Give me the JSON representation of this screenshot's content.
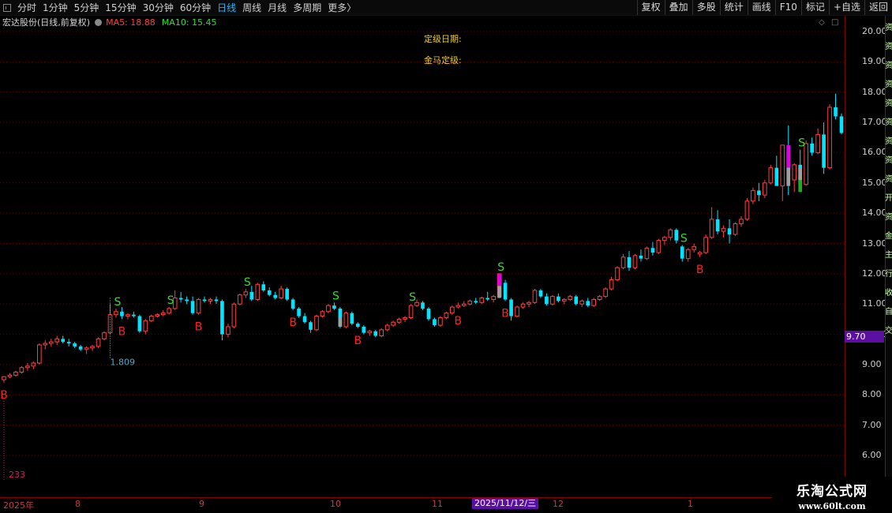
{
  "toolbar": {
    "periods": [
      "分时",
      "1分钟",
      "5分钟",
      "15分钟",
      "30分钟",
      "60分钟",
      "日线",
      "周线",
      "月线",
      "多周期",
      "更多"
    ],
    "active_period": "日线",
    "more_arrow": "〉",
    "right_buttons": [
      "复权",
      "叠加",
      "多股",
      "统计",
      "画线",
      "F10",
      "标记",
      "+自选",
      "返回"
    ]
  },
  "info": {
    "stock_name": "宏达股份(日线,前复权)",
    "ma5_label": "MA5: 18.88",
    "ma10_label": "MA10: 15.45"
  },
  "annotations": {
    "rating_date": "定级日期:",
    "golden_horse": "金马定级:"
  },
  "y_axis": {
    "ticks": [
      "20.00",
      "19.00",
      "18.00",
      "17.00",
      "16.00",
      "15.00",
      "14.00",
      "13.00",
      "12.00",
      "11.00",
      "10.00",
      "9.00",
      "8.00",
      "7.00",
      "6.00"
    ]
  },
  "current_price_tag": "9.70",
  "x_axis": {
    "labels": [
      "2025年",
      "8",
      "9",
      "10",
      "11",
      "12",
      "1"
    ],
    "cursor_date": "2025/11/12/三"
  },
  "chart_marks": {
    "low_marker": "1.809",
    "volume_marker": "233",
    "buy_label": "B",
    "sell_label": "S"
  },
  "right_strip": [
    "资",
    "资",
    "资",
    "资",
    "资",
    "资",
    "资",
    "资",
    "资",
    "开",
    "资",
    "金",
    "主",
    "行",
    "收",
    "自",
    "交"
  ],
  "watermark": {
    "line1": "乐淘公式网",
    "line2": "www.60lt.com"
  },
  "colors": {
    "up": "#ff4040",
    "down": "#00e5ff",
    "buy": "#ff2020",
    "sell": "#33dd33",
    "magenta": "#e000e0",
    "gray": "#a0a0a0",
    "green": "#22aa22"
  },
  "chart_data": {
    "type": "candlestick",
    "title": "",
    "ylim": [
      5.6,
      20.3
    ],
    "candles": [
      [
        8.5,
        8.62,
        8.4,
        8.6
      ],
      [
        8.6,
        8.72,
        8.55,
        8.65
      ],
      [
        8.65,
        8.8,
        8.6,
        8.75
      ],
      [
        8.75,
        8.95,
        8.7,
        8.9
      ],
      [
        8.9,
        9.05,
        8.8,
        8.95
      ],
      [
        8.95,
        9.1,
        8.85,
        9.05
      ],
      [
        9.05,
        9.7,
        9.0,
        9.65
      ],
      [
        9.65,
        9.8,
        9.5,
        9.7
      ],
      [
        9.7,
        9.85,
        9.6,
        9.75
      ],
      [
        9.75,
        9.95,
        9.65,
        9.85
      ],
      [
        9.85,
        9.95,
        9.7,
        9.75
      ],
      [
        9.75,
        9.85,
        9.6,
        9.7
      ],
      [
        9.7,
        9.75,
        9.55,
        9.6
      ],
      [
        9.6,
        9.65,
        9.45,
        9.5
      ],
      [
        9.5,
        9.6,
        9.35,
        9.55
      ],
      [
        9.55,
        9.65,
        9.45,
        9.6
      ],
      [
        9.6,
        9.9,
        9.55,
        9.85
      ],
      [
        9.85,
        10.1,
        9.8,
        10.05
      ],
      [
        10.05,
        11.0,
        10.0,
        10.65
      ],
      [
        10.65,
        10.85,
        10.55,
        10.75
      ],
      [
        10.75,
        10.9,
        10.5,
        10.6
      ],
      [
        10.6,
        10.7,
        10.5,
        10.65
      ],
      [
        10.65,
        10.75,
        10.55,
        10.6
      ],
      [
        10.6,
        10.65,
        10.05,
        10.1
      ],
      [
        10.1,
        10.5,
        10.0,
        10.45
      ],
      [
        10.45,
        10.65,
        10.4,
        10.6
      ],
      [
        10.6,
        10.7,
        10.55,
        10.65
      ],
      [
        10.65,
        10.8,
        10.6,
        10.7
      ],
      [
        10.7,
        10.9,
        10.65,
        10.85
      ],
      [
        10.85,
        11.45,
        10.8,
        11.2
      ],
      [
        11.2,
        11.4,
        11.05,
        11.15
      ],
      [
        11.15,
        11.25,
        11.0,
        11.1
      ],
      [
        11.1,
        11.25,
        10.65,
        10.7
      ],
      [
        10.7,
        11.2,
        10.65,
        11.15
      ],
      [
        11.15,
        11.25,
        11.05,
        11.1
      ],
      [
        11.1,
        11.2,
        11.0,
        11.15
      ],
      [
        11.15,
        11.25,
        11.0,
        11.1
      ],
      [
        11.1,
        11.15,
        9.8,
        10.0
      ],
      [
        10.0,
        10.35,
        9.9,
        10.25
      ],
      [
        10.25,
        11.05,
        10.2,
        11.0
      ],
      [
        11.0,
        11.35,
        10.95,
        11.3
      ],
      [
        11.3,
        11.5,
        11.2,
        11.4
      ],
      [
        11.4,
        11.6,
        11.1,
        11.15
      ],
      [
        11.15,
        11.7,
        11.1,
        11.65
      ],
      [
        11.65,
        11.75,
        11.4,
        11.45
      ],
      [
        11.45,
        11.55,
        11.25,
        11.3
      ],
      [
        11.3,
        11.4,
        11.15,
        11.2
      ],
      [
        11.2,
        11.6,
        11.15,
        11.5
      ],
      [
        11.5,
        11.55,
        11.1,
        11.15
      ],
      [
        11.15,
        11.2,
        10.8,
        10.85
      ],
      [
        10.85,
        10.9,
        10.55,
        10.6
      ],
      [
        10.6,
        10.7,
        10.35,
        10.4
      ],
      [
        10.4,
        10.45,
        10.05,
        10.15
      ],
      [
        10.15,
        10.65,
        10.1,
        10.6
      ],
      [
        10.6,
        10.8,
        10.55,
        10.75
      ],
      [
        10.75,
        11.0,
        10.7,
        10.95
      ],
      [
        10.95,
        11.05,
        10.8,
        10.85
      ],
      [
        10.85,
        10.9,
        10.2,
        10.25
      ],
      [
        10.25,
        10.75,
        10.2,
        10.7
      ],
      [
        10.7,
        10.75,
        10.3,
        10.35
      ],
      [
        10.35,
        10.4,
        10.2,
        10.25
      ],
      [
        10.25,
        10.3,
        10.0,
        10.05
      ],
      [
        10.05,
        10.15,
        9.95,
        10.1
      ],
      [
        10.1,
        10.15,
        9.9,
        9.95
      ],
      [
        9.95,
        10.2,
        9.9,
        10.15
      ],
      [
        10.15,
        10.35,
        10.1,
        10.3
      ],
      [
        10.3,
        10.45,
        10.25,
        10.4
      ],
      [
        10.4,
        10.55,
        10.35,
        10.5
      ],
      [
        10.5,
        10.6,
        10.4,
        10.55
      ],
      [
        10.55,
        11.0,
        10.5,
        10.95
      ],
      [
        10.95,
        11.15,
        10.9,
        11.05
      ],
      [
        11.05,
        11.1,
        10.8,
        10.85
      ],
      [
        10.85,
        10.9,
        10.45,
        10.5
      ],
      [
        10.5,
        10.55,
        10.25,
        10.3
      ],
      [
        10.3,
        10.6,
        10.25,
        10.55
      ],
      [
        10.55,
        10.75,
        10.5,
        10.7
      ],
      [
        10.7,
        10.95,
        10.65,
        10.9
      ],
      [
        10.9,
        11.05,
        10.85,
        10.95
      ],
      [
        10.95,
        11.1,
        10.9,
        11.0
      ],
      [
        11.0,
        11.15,
        10.95,
        11.1
      ],
      [
        11.1,
        11.2,
        11.0,
        11.05
      ],
      [
        11.05,
        11.25,
        11.0,
        11.2
      ],
      [
        11.2,
        11.4,
        11.1,
        11.15
      ],
      [
        11.15,
        11.3,
        11.05,
        11.25
      ],
      [
        11.25,
        12.0,
        11.2,
        12.0
      ],
      [
        11.7,
        11.8,
        11.1,
        11.15
      ],
      [
        11.15,
        11.2,
        10.45,
        10.6
      ],
      [
        10.6,
        10.95,
        10.55,
        10.9
      ],
      [
        10.9,
        11.05,
        10.85,
        11.0
      ],
      [
        11.0,
        11.1,
        10.9,
        11.05
      ],
      [
        11.05,
        11.5,
        11.0,
        11.45
      ],
      [
        11.45,
        11.5,
        11.2,
        11.25
      ],
      [
        11.25,
        11.35,
        10.95,
        11.0
      ],
      [
        11.0,
        11.3,
        10.95,
        11.25
      ],
      [
        11.25,
        11.35,
        11.05,
        11.1
      ],
      [
        11.1,
        11.2,
        11.0,
        11.15
      ],
      [
        11.15,
        11.3,
        11.1,
        11.25
      ],
      [
        11.25,
        11.3,
        10.95,
        11.0
      ],
      [
        11.0,
        11.15,
        10.9,
        11.1
      ],
      [
        11.1,
        11.2,
        10.9,
        10.95
      ],
      [
        10.95,
        11.2,
        10.9,
        11.15
      ],
      [
        11.15,
        11.3,
        11.1,
        11.25
      ],
      [
        11.25,
        11.55,
        11.2,
        11.5
      ],
      [
        11.5,
        11.9,
        11.45,
        11.8
      ],
      [
        11.8,
        12.25,
        11.75,
        12.2
      ],
      [
        12.2,
        12.65,
        12.15,
        12.55
      ],
      [
        12.55,
        12.75,
        12.1,
        12.2
      ],
      [
        12.2,
        12.65,
        12.15,
        12.6
      ],
      [
        12.6,
        12.8,
        12.4,
        12.5
      ],
      [
        12.5,
        12.9,
        12.45,
        12.85
      ],
      [
        12.85,
        13.05,
        12.6,
        12.7
      ],
      [
        12.7,
        13.15,
        12.65,
        13.1
      ],
      [
        13.1,
        13.25,
        12.95,
        13.2
      ],
      [
        13.2,
        13.5,
        13.1,
        13.45
      ],
      [
        13.45,
        13.5,
        13.0,
        13.1
      ],
      [
        12.9,
        12.95,
        12.4,
        12.5
      ],
      [
        12.5,
        12.85,
        12.4,
        12.8
      ],
      [
        12.8,
        13.0,
        12.7,
        12.9
      ],
      [
        12.65,
        12.75,
        12.55,
        12.7
      ],
      [
        12.7,
        13.3,
        12.65,
        13.2
      ],
      [
        13.2,
        14.2,
        13.15,
        13.8
      ],
      [
        13.8,
        14.1,
        13.3,
        13.4
      ],
      [
        13.4,
        13.6,
        13.2,
        13.5
      ],
      [
        13.5,
        13.8,
        13.0,
        13.3
      ],
      [
        13.3,
        13.7,
        13.25,
        13.65
      ],
      [
        13.65,
        13.9,
        13.55,
        13.8
      ],
      [
        13.8,
        14.5,
        13.75,
        14.4
      ],
      [
        14.4,
        14.85,
        14.3,
        14.75
      ],
      [
        14.75,
        15.0,
        14.4,
        14.6
      ],
      [
        14.6,
        15.1,
        14.5,
        15.0
      ],
      [
        15.0,
        15.6,
        14.95,
        15.5
      ],
      [
        15.5,
        15.9,
        15.3,
        14.9
      ],
      [
        14.9,
        16.2,
        14.4,
        16.25
      ],
      [
        16.2,
        16.9,
        14.6,
        15.1
      ],
      [
        15.1,
        15.65,
        14.7,
        15.6
      ],
      [
        15.6,
        16.1,
        14.8,
        14.95
      ],
      [
        14.95,
        16.4,
        14.9,
        16.3
      ],
      [
        16.3,
        16.5,
        15.9,
        16.0
      ],
      [
        16.0,
        16.8,
        15.95,
        16.6
      ],
      [
        16.6,
        17.0,
        15.3,
        15.5
      ],
      [
        15.5,
        17.6,
        15.45,
        17.5
      ],
      [
        17.5,
        17.95,
        17.1,
        17.2
      ],
      [
        17.2,
        17.3,
        16.6,
        16.65
      ]
    ],
    "buy_signal_indices": [
      0,
      20,
      33,
      49,
      60,
      77,
      85,
      118
    ],
    "sell_signal_indices": [
      19,
      28,
      41,
      56,
      69,
      84,
      115,
      135
    ]
  }
}
